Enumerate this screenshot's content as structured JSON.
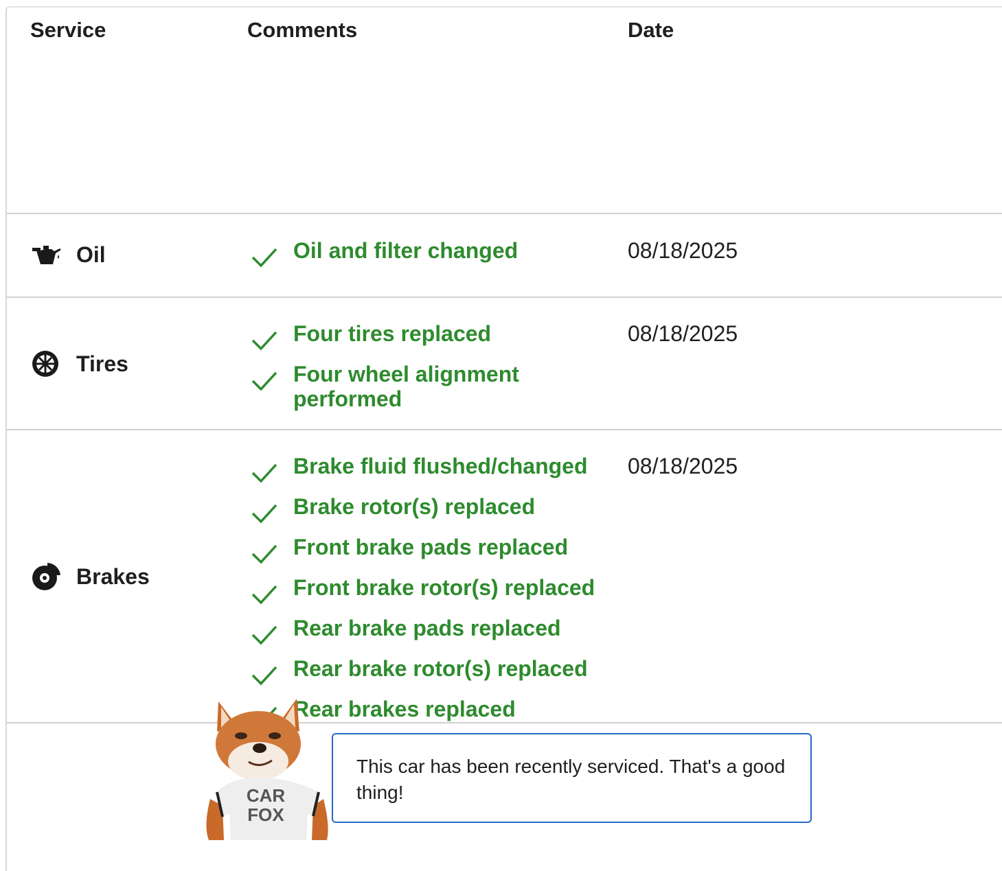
{
  "table": {
    "headers": {
      "service": "Service",
      "comments": "Comments",
      "date": "Date"
    },
    "rows": [
      {
        "service": "Oil",
        "icon": "oil-can-icon",
        "date": "08/18/2025",
        "comments": [
          "Oil and filter changed"
        ]
      },
      {
        "service": "Tires",
        "icon": "tire-icon",
        "date": "08/18/2025",
        "comments": [
          "Four tires replaced",
          "Four wheel alignment performed"
        ]
      },
      {
        "service": "Brakes",
        "icon": "brake-disc-icon",
        "date": "08/18/2025",
        "comments": [
          "Brake fluid flushed/changed",
          "Brake rotor(s) replaced",
          "Front brake pads replaced",
          "Front brake rotor(s) replaced",
          "Rear brake pads replaced",
          "Rear brake rotor(s) replaced",
          "Rear brakes replaced"
        ]
      }
    ]
  },
  "mascot": {
    "shirt_text_line1": "CAR",
    "shirt_text_line2": "FOX"
  },
  "callout": {
    "text": "This car has been recently serviced. That's a good thing!"
  },
  "colors": {
    "comment_green": "#2e8b2e",
    "callout_border": "#2468c8"
  }
}
